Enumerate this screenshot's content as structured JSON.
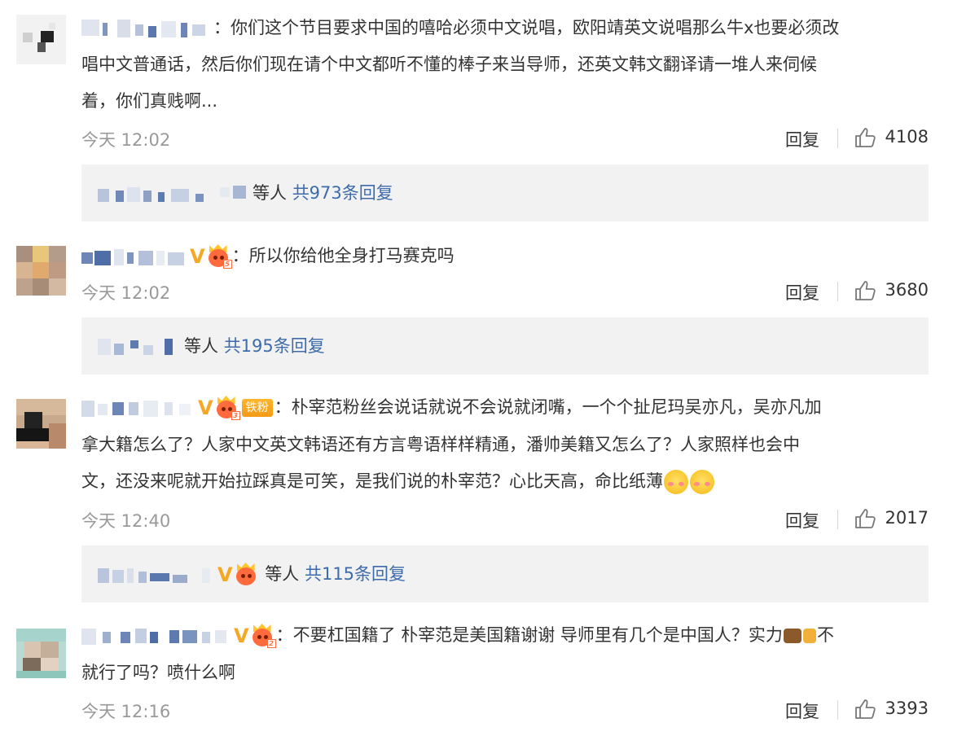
{
  "comments": [
    {
      "text_lines": [
        "你们这个节目要求中国的嘻哈必须中文说唱，欧阳靖英文说唱那么牛x也要必须改",
        "唱中文普通话，然后你们现在请个中文都听不懂的棒子来当导师，还英文韩文翻译请一堆人来伺候",
        "着，你们真贱啊..."
      ],
      "time": "今天 12:02",
      "reply_label": "回复",
      "likes": "4108",
      "sub_suffix": "等人",
      "sub_count": "共973条回复"
    },
    {
      "text": "所以你给他全身打马赛克吗",
      "time": "今天 12:02",
      "reply_label": "回复",
      "likes": "3680",
      "sub_suffix": "等人",
      "sub_count": "共195条回复"
    },
    {
      "fan_badge": "铁粉",
      "text_first": "朴宰范粉丝会说话就说不会说就闭嘴，一个个扯尼玛吴亦凡，吴亦凡加",
      "text_lines": [
        "拿大籍怎么了？人家中文英文韩语还有方言粤语样样精通，潘帅美籍又怎么了？人家照样也会中"
      ],
      "text_last": "文，还没来呢就开始拉踩真是可笑，是我们说的朴宰范？心比天高，命比纸薄",
      "time": "今天 12:40",
      "reply_label": "回复",
      "likes": "2017",
      "sub_suffix": "等人",
      "sub_count": "共115条回复"
    },
    {
      "text_first": "不要杠国籍了 朴宰范是美国籍谢谢 导师里有几个是中国人？实力",
      "text_after_emoji": "不",
      "text_last": "就行了吗？喷什么啊",
      "time": "今天 12:16",
      "reply_label": "回复",
      "likes": "3393"
    }
  ],
  "separator": "：",
  "icons": {
    "like": "thumbs-up-icon",
    "vip": "v-badge-icon",
    "crown": "crown-level-icon",
    "emoji_blush": "blush-emoji-icon",
    "emoji_cow": "cow-emoji-icon",
    "emoji_beer": "beer-emoji-icon"
  },
  "colors": {
    "link": "#3d6bab",
    "meta": "#999999",
    "text": "#333333",
    "reply_bg": "#f2f2f2",
    "vip": "#f4a823"
  }
}
